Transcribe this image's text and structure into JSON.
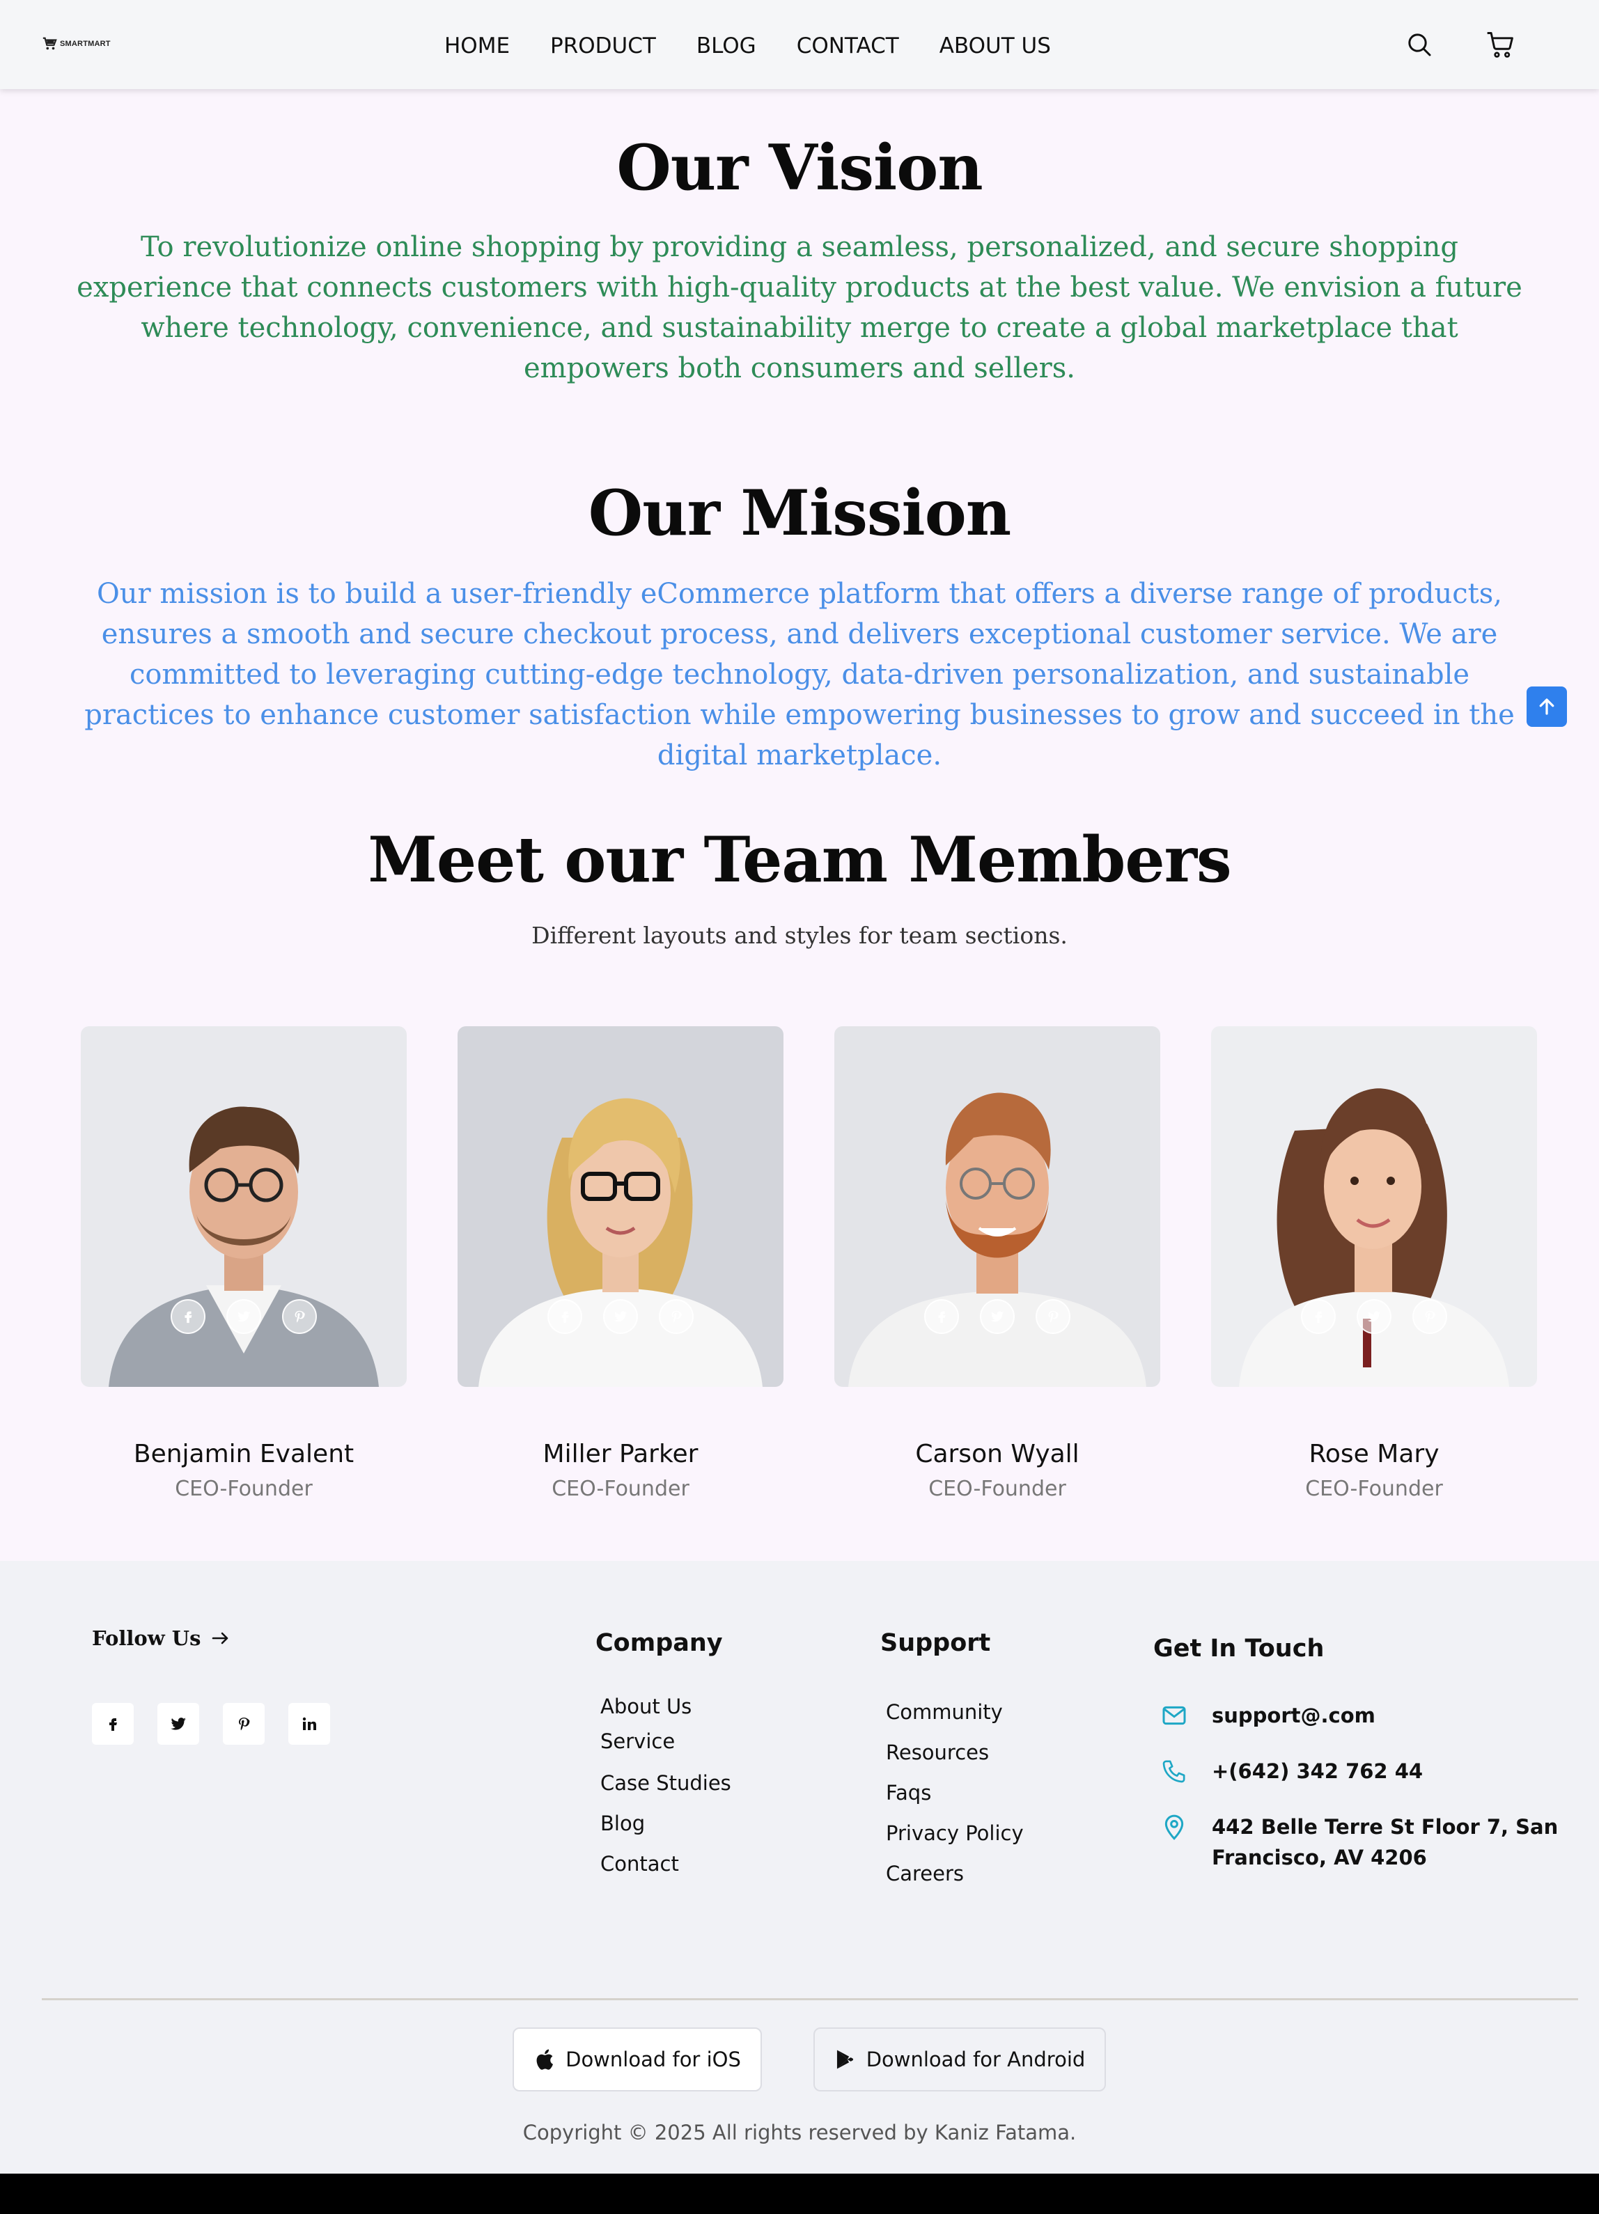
{
  "brand": {
    "logo_text": "SMARTMART"
  },
  "nav": {
    "items": [
      "HOME",
      "PRODUCT",
      "BLOG",
      "CONTACT",
      "ABOUT US"
    ],
    "icons": [
      "search-icon",
      "cart-icon"
    ]
  },
  "vision": {
    "title": "Our Vision",
    "text": "To revolutionize online shopping by providing a seamless, personalized, and secure shopping experience that connects customers with high-quality products at the best value. We envision a future where technology, convenience, and sustainability merge to create a global marketplace that empowers both consumers and sellers."
  },
  "mission": {
    "title": "Our Mission",
    "text": "Our mission is to build a user-friendly eCommerce platform that offers a diverse range of products, ensures a smooth and secure checkout process, and delivers exceptional customer service. We are committed to leveraging cutting-edge technology, data-driven personalization, and sustainable practices to enhance customer satisfaction while empowering businesses to grow and succeed in the digital marketplace."
  },
  "team": {
    "title": "Meet our Team Members",
    "subtitle": "Different layouts and styles for team sections.",
    "members": [
      {
        "name": "Benjamin Evalent",
        "role": "CEO-Founder"
      },
      {
        "name": "Miller Parker",
        "role": "CEO-Founder"
      },
      {
        "name": "Carson Wyall",
        "role": "CEO-Founder"
      },
      {
        "name": "Rose Mary",
        "role": "CEO-Founder"
      }
    ]
  },
  "footer": {
    "follow_label": "Follow Us",
    "social_icons": [
      "facebook-icon",
      "twitter-icon",
      "pinterest-icon",
      "linkedin-icon"
    ],
    "company": {
      "title": "Company",
      "links": [
        "About Us",
        "Service",
        "Case Studies",
        "Blog",
        "Contact"
      ]
    },
    "support": {
      "title": "Support",
      "links": [
        "Community",
        "Resources",
        "Faqs",
        "Privacy Policy",
        "Careers"
      ]
    },
    "contact": {
      "title": "Get In Touch",
      "email": "support@.com",
      "phone": "+(642) 342 762 44",
      "address_line1": "442 Belle Terre St Floor 7, San",
      "address_line2": "Francisco, AV 4206"
    },
    "download_ios": "Download for iOS",
    "download_android": "Download for Android",
    "copyright": "Copyright © 2025 All rights reserved by Kaniz Fatama."
  },
  "colors": {
    "vision_text": "#2e8b57",
    "mission_text": "#4a8fe7",
    "accent": "#2f80ed",
    "contact_icon": "#1ea7c5"
  }
}
